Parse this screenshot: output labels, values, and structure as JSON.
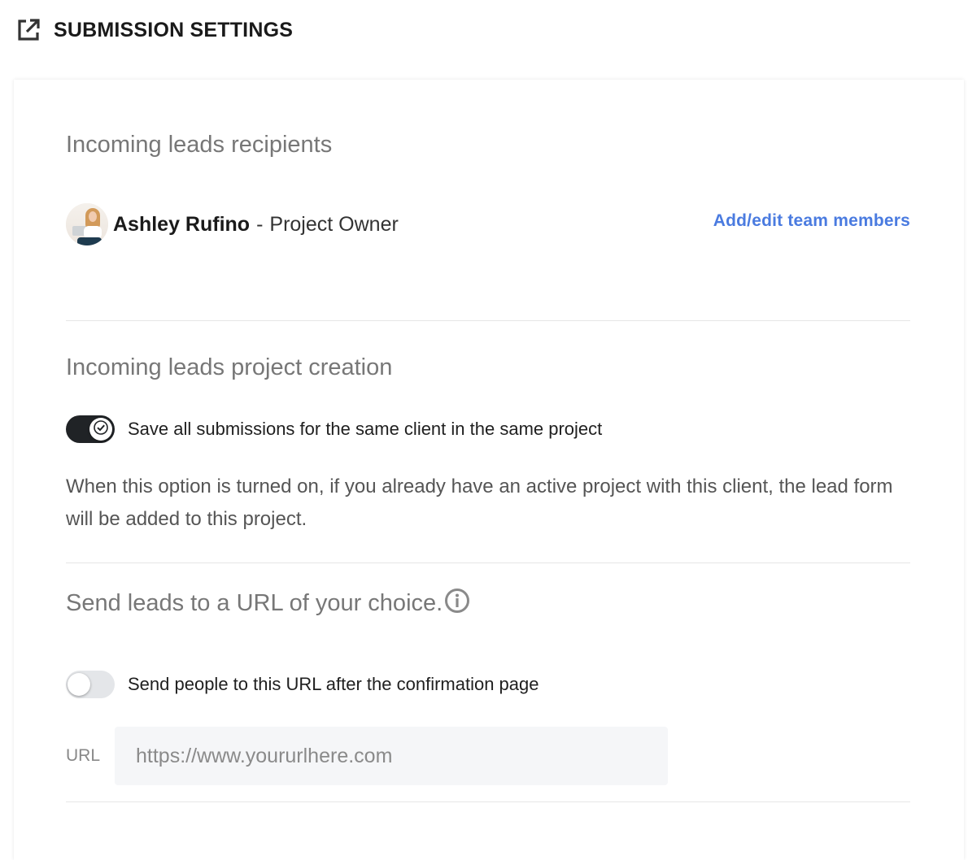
{
  "header": {
    "title": "SUBMISSION SETTINGS",
    "icon": "external-link-icon"
  },
  "recipients": {
    "section_title": "Incoming leads recipients",
    "person": {
      "name": "Ashley Rufino",
      "separator": "-",
      "role": "Project Owner"
    },
    "team_link": "Add/edit team members"
  },
  "project_creation": {
    "section_title": "Incoming leads project creation",
    "toggle_label": "Save all submissions for the same client in the same project",
    "toggle_on": true,
    "help_text": "When this option is turned on, if you already have an active project with this client, the lead form will be added to this project."
  },
  "send_url": {
    "section_title": "Send leads to a URL of your choice.",
    "info_icon": "info-icon",
    "toggle_label": "Send people to this URL after the confirmation page",
    "toggle_on": false,
    "url_label": "URL",
    "url_placeholder": "https://www.yoururlhere.com",
    "url_value": ""
  },
  "colors": {
    "link": "#4a7be0",
    "toggle_on": "#202326",
    "toggle_off": "#e4e6e9",
    "section_title": "#777777"
  }
}
